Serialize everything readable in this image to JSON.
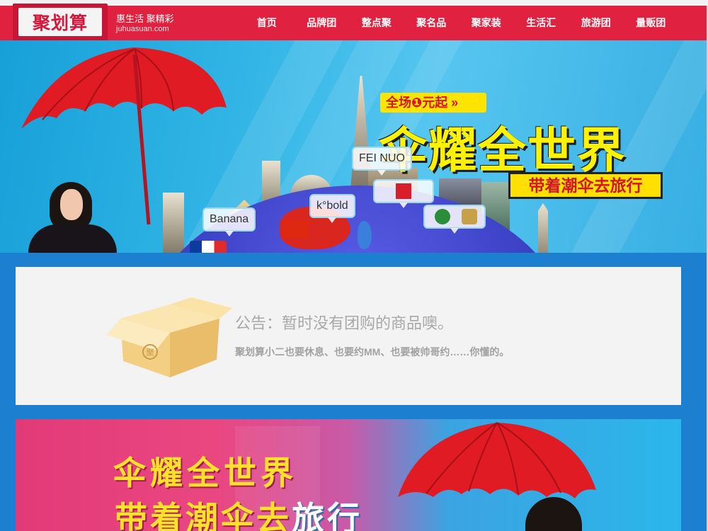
{
  "header": {
    "logo": "聚划算",
    "slogan": "惠生活 聚精彩",
    "domain": "juhuasuan.com",
    "nav": [
      "首页",
      "品牌团",
      "整点聚",
      "聚名品",
      "聚家装",
      "生活汇",
      "旅游团",
      "量贩团"
    ]
  },
  "hero": {
    "promo_pill": "全场❶元起 »",
    "title": "伞耀全世界",
    "subtitle": "带着潮伞去旅行",
    "brands": [
      "FEI NUO",
      "Banana",
      "k°bold"
    ]
  },
  "notice": {
    "title": "公告：暂时没有团购的商品噢。",
    "description": "聚划算小二也要休息、也要约MM、也要被帅哥约……你懂的。",
    "box_stamp": "聚"
  },
  "promo_banner": {
    "line1": "伞耀全世界",
    "line2_a": "带着潮伞去",
    "line2_b": "旅行"
  },
  "colors": {
    "header_red": "#e0213f",
    "page_blue": "#1c7fd0",
    "banner_yellow": "#fff200"
  }
}
